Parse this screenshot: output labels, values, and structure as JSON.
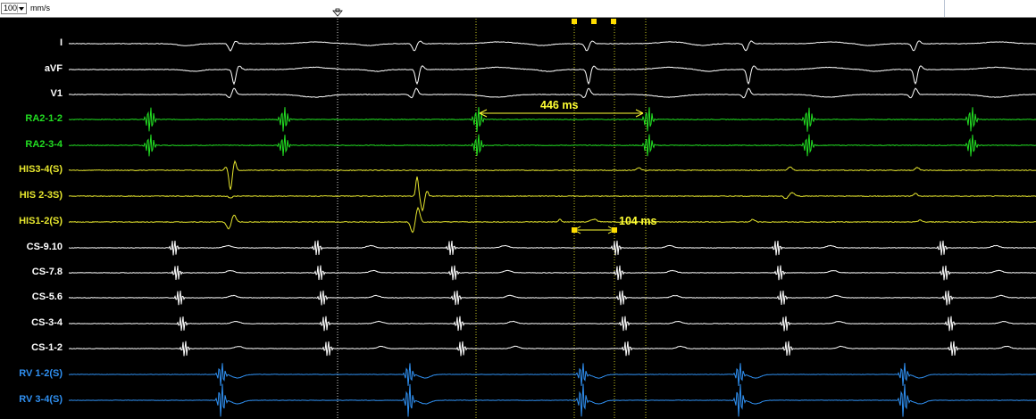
{
  "toolbar": {
    "speed_value": "100",
    "speed_unit": "mm/s"
  },
  "channels": [
    {
      "label": "I",
      "color": "#ffffff"
    },
    {
      "label": "aVF",
      "color": "#ffffff"
    },
    {
      "label": "V1",
      "color": "#ffffff"
    },
    {
      "label": "RA2-1-2",
      "color": "#22dd22"
    },
    {
      "label": "RA2-3-4",
      "color": "#22dd22"
    },
    {
      "label": "HIS3-4(S)",
      "color": "#e6e62e"
    },
    {
      "label": "HIS 2-3S)",
      "color": "#e6e62e"
    },
    {
      "label": "HIS1-2(S)",
      "color": "#e6e62e"
    },
    {
      "label": "CS-9.10",
      "color": "#ffffff"
    },
    {
      "label": "CS-7.8",
      "color": "#ffffff"
    },
    {
      "label": "CS-5.6",
      "color": "#ffffff"
    },
    {
      "label": "CS-3-4",
      "color": "#ffffff"
    },
    {
      "label": "CS-1-2",
      "color": "#ffffff"
    },
    {
      "label": "RV 1-2(S)",
      "color": "#2f8ff0"
    },
    {
      "label": "RV 3-4(S)",
      "color": "#2f8ff0"
    }
  ],
  "measurements": [
    {
      "text": "446 ms"
    },
    {
      "text": "104 ms"
    }
  ],
  "colors": {
    "ecg": "#ffffff",
    "ra": "#22dd22",
    "his": "#e6e62e",
    "cs": "#ffffff",
    "rv": "#2f8ff0",
    "caliper": "#ffff33"
  },
  "icons": [
    "dropdown-caret-icon",
    "cursor-marker-icon",
    "caliper-handle-icon"
  ]
}
